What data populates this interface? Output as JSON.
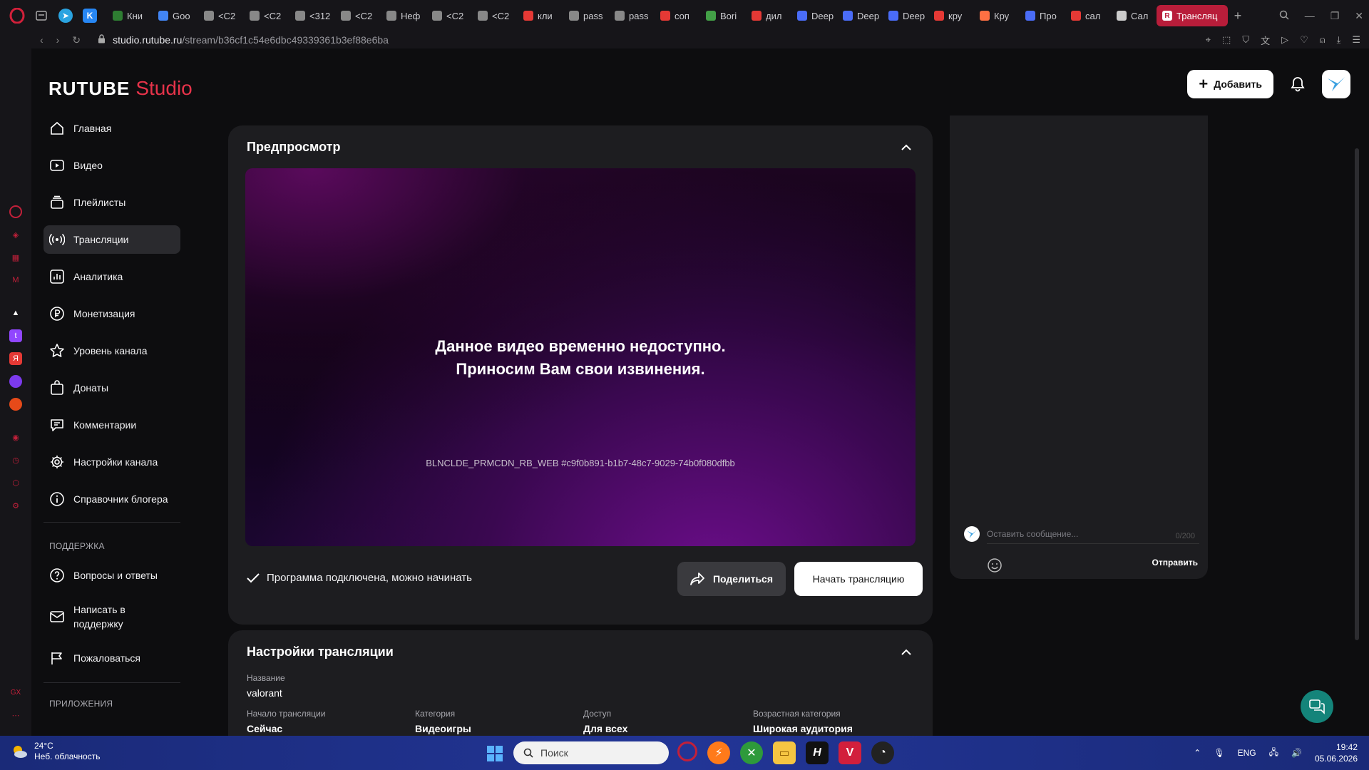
{
  "browser": {
    "tabs": [
      {
        "label": "Кни",
        "color": "#2e7d32"
      },
      {
        "label": "Goo",
        "color": "#4285f4"
      },
      {
        "label": "<C2",
        "color": "#888888"
      },
      {
        "label": "<C2",
        "color": "#888888"
      },
      {
        "label": "<312",
        "color": "#888888"
      },
      {
        "label": "<C2",
        "color": "#888888"
      },
      {
        "label": "Неф",
        "color": "#888888"
      },
      {
        "label": "<C2",
        "color": "#888888"
      },
      {
        "label": "<C2",
        "color": "#888888"
      },
      {
        "label": "кли",
        "color": "#e53935"
      },
      {
        "label": "pass",
        "color": "#888888"
      },
      {
        "label": "pass",
        "color": "#888888"
      },
      {
        "label": "соп",
        "color": "#e53935"
      },
      {
        "label": "Bori",
        "color": "#43a047"
      },
      {
        "label": "дил",
        "color": "#e53935"
      },
      {
        "label": "Deep",
        "color": "#4a6cf7"
      },
      {
        "label": "Deep",
        "color": "#4a6cf7"
      },
      {
        "label": "Deep",
        "color": "#4a6cf7"
      },
      {
        "label": "кру",
        "color": "#e53935"
      },
      {
        "label": "Кру",
        "color": "#ff7043"
      },
      {
        "label": "Про",
        "color": "#4a6cf7"
      },
      {
        "label": "сал",
        "color": "#e53935"
      },
      {
        "label": "Сал",
        "color": "#cccccc"
      }
    ],
    "active_tab": "Трансляц",
    "url_host": "studio.rutube.ru",
    "url_path": "/stream/b36cf1c54e6dbc49339361b3ef88e6ba"
  },
  "app": {
    "logo_main": "RUTUBE",
    "logo_studio": "Studio",
    "add_label": "Добавить",
    "accent": "#e6334a"
  },
  "nav": {
    "items": [
      {
        "label": "Главная",
        "icon": "home-icon"
      },
      {
        "label": "Видео",
        "icon": "video-icon"
      },
      {
        "label": "Плейлисты",
        "icon": "playlist-icon"
      },
      {
        "label": "Трансляции",
        "icon": "broadcast-icon"
      },
      {
        "label": "Аналитика",
        "icon": "analytics-icon"
      },
      {
        "label": "Монетизация",
        "icon": "ruble-icon"
      },
      {
        "label": "Уровень канала",
        "icon": "star-icon"
      },
      {
        "label": "Донаты",
        "icon": "bag-icon"
      },
      {
        "label": "Комментарии",
        "icon": "comment-icon"
      },
      {
        "label": "Настройки канала",
        "icon": "gear-icon"
      },
      {
        "label": "Справочник блогера",
        "icon": "info-icon"
      }
    ],
    "support_title": "ПОДДЕРЖКА",
    "support_items": [
      {
        "label": "Вопросы и ответы",
        "icon": "question-icon"
      },
      {
        "label": "Написать в поддержку",
        "icon": "mail-icon"
      },
      {
        "label": "Пожаловаться",
        "icon": "flag-icon"
      }
    ],
    "apps_title": "ПРИЛОЖЕНИЯ"
  },
  "preview": {
    "title": "Предпросмотр",
    "message_line1": "Данное видео временно недоступно.",
    "message_line2": "Приносим Вам свои извинения.",
    "error_code": "BLNCLDE_PRMCDN_RB_WEB #c9f0b891-b1b7-48c7-9029-74b0f080dfbb",
    "status": "Программа подключена, можно начинать",
    "share_label": "Поделиться",
    "start_label": "Начать трансляцию"
  },
  "settings": {
    "title": "Настройки трансляции",
    "name_label": "Название",
    "name_value": "valorant",
    "start_label": "Начало трансляции",
    "start_value": "Сейчас",
    "category_label": "Категория",
    "category_value": "Видеоигры",
    "access_label": "Доступ",
    "access_value": "Для всех",
    "age_label": "Возрастная категория",
    "age_value": "Широкая аудитория"
  },
  "chat": {
    "placeholder": "Оставить сообщение...",
    "counter": "0/200",
    "send_label": "Отправить"
  },
  "taskbar": {
    "temp": "24°C",
    "weather": "Неб. облачность",
    "search_placeholder": "Поиск",
    "lang": "ENG",
    "time": "19:42",
    "date": "05.06.2026"
  }
}
